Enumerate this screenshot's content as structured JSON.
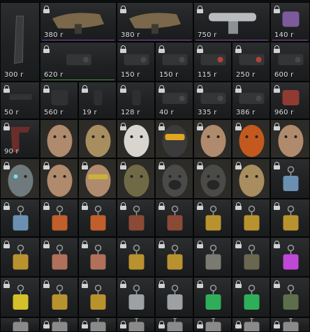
{
  "rows": [
    [
      {
        "icon": "magazine-icon",
        "price": "300 r",
        "span": 2
      },
      {
        "icon": "desert-rifle-stock-icon",
        "price": "380 r",
        "locked": true,
        "wide": 2,
        "underline": "#7a4aa8"
      },
      {
        "icon": "desert-rifle-stock-icon",
        "price": "380 r",
        "locked": true,
        "wide": 2,
        "underline": "#7a4aa8"
      },
      {
        "icon": "silver-scope-icon",
        "price": "750 r",
        "locked": true,
        "wide": 2,
        "underline": "#7a4aa8"
      },
      {
        "icon": "purple-suppressor-icon",
        "price": "140 r",
        "locked": true,
        "underline": "#7a4aa8"
      }
    ],
    [
      {
        "icon": "sniper-scope-icon",
        "price": "620 r",
        "locked": true,
        "wide": 2,
        "underline": "#3f8c3a"
      },
      {
        "icon": "holo-sight-icon",
        "price": "150 r",
        "locked": true
      },
      {
        "icon": "holo-sight-icon",
        "price": "150 r",
        "locked": true
      },
      {
        "icon": "red-dot-sight-icon",
        "price": "115 r",
        "locked": true
      },
      {
        "icon": "red-dot-sight-icon",
        "price": "250 r",
        "locked": true
      },
      {
        "icon": "night-scope-icon",
        "price": "600 r",
        "locked": true
      }
    ],
    [
      {
        "icon": "rail-mount-icon",
        "price": "50 r",
        "locked": true
      },
      {
        "icon": "suppressor-icon",
        "price": "560 r",
        "locked": true
      },
      {
        "icon": "grip-icon",
        "price": "19 r",
        "locked": true
      },
      {
        "icon": "flash-hider-icon",
        "price": "128 r",
        "locked": true
      },
      {
        "icon": "laser-sight-icon",
        "price": "40 r",
        "locked": true
      },
      {
        "icon": "thermal-scope-icon",
        "price": "335 r",
        "locked": true
      },
      {
        "icon": "thermal-scope-icon",
        "price": "386 r",
        "locked": true
      },
      {
        "icon": "red-suppressor-icon",
        "price": "960 r",
        "locked": true
      }
    ],
    [
      {
        "icon": "foregrip-icon",
        "price": "90 r",
        "locked": true
      },
      {
        "icon": "soldier-face-icon",
        "face": true
      },
      {
        "icon": "balaclava-face-icon",
        "face": true
      },
      {
        "icon": "skull-mask-face-icon",
        "face": true,
        "locked": true
      },
      {
        "icon": "goggles-helmet-face-icon",
        "face": true,
        "locked": true
      },
      {
        "icon": "bearded-face-icon",
        "face": true,
        "locked": true
      },
      {
        "icon": "orange-skull-face-icon",
        "face": true,
        "locked": true
      },
      {
        "icon": "soldier-face-icon",
        "face": true,
        "locked": true
      }
    ],
    [
      {
        "icon": "cyborg-face-icon",
        "face": true,
        "locked": true
      },
      {
        "icon": "soldier-face-icon",
        "face": true,
        "locked": true
      },
      {
        "icon": "sunglasses-face-icon",
        "face": true,
        "locked": true
      },
      {
        "icon": "camo-face-icon",
        "face": true,
        "locked": true
      },
      {
        "icon": "gasmask-face-icon",
        "face": true,
        "locked": true
      },
      {
        "icon": "respirator-face-icon",
        "face": true,
        "locked": true
      },
      {
        "icon": "balaclava-face-icon",
        "face": true,
        "locked": true
      },
      {
        "icon": "gear-charm-icon",
        "locked": true
      }
    ],
    [
      {
        "icon": "gear-charm-icon",
        "locked": true
      },
      {
        "icon": "carrot-charm-icon",
        "locked": true
      },
      {
        "icon": "carrot-charm-icon",
        "locked": true
      },
      {
        "icon": "sun-plate-charm-icon",
        "locked": true
      },
      {
        "icon": "sun-plate-charm-icon",
        "locked": true
      },
      {
        "icon": "gold-badge-charm-icon",
        "locked": true
      },
      {
        "icon": "gold-badge-charm-icon",
        "locked": true
      },
      {
        "icon": "gold-badge-charm-icon",
        "locked": true
      }
    ],
    [
      {
        "icon": "gold-badge-charm-icon",
        "locked": true
      },
      {
        "icon": "copper-dogtag-charm-icon",
        "locked": true
      },
      {
        "icon": "copper-dogtag-charm-icon",
        "locked": true
      },
      {
        "icon": "gold-plate-charm-icon",
        "locked": true
      },
      {
        "icon": "gold-plate-charm-icon",
        "locked": true
      },
      {
        "icon": "pumpkin-hammer-charm-icon",
        "locked": true
      },
      {
        "icon": "stone-head-charm-icon",
        "locked": true
      },
      {
        "icon": "purple-vial-charm-icon",
        "locked": true
      }
    ],
    [
      {
        "icon": "yellow-x-charm-icon",
        "locked": true
      },
      {
        "icon": "gold-triangle-charm-icon",
        "locked": true
      },
      {
        "icon": "gold-triangle-charm-icon",
        "locked": true
      },
      {
        "icon": "silver-dogtag-charm-icon",
        "locked": true
      },
      {
        "icon": "silver-dogtag-charm-icon",
        "locked": true
      },
      {
        "icon": "green-canister-charm-icon",
        "locked": true
      },
      {
        "icon": "green-canister-charm-icon",
        "locked": true
      },
      {
        "icon": "robot-charm-icon",
        "locked": true
      }
    ],
    [
      {
        "icon": "charm-icon"
      },
      {
        "icon": "charm-icon",
        "locked": true
      },
      {
        "icon": "charm-icon",
        "locked": true
      },
      {
        "icon": "charm-icon",
        "locked": true
      },
      {
        "icon": "charm-icon",
        "locked": true
      },
      {
        "icon": "charm-icon",
        "locked": true
      },
      {
        "icon": "charm-icon",
        "locked": true
      },
      {
        "icon": "charm-icon",
        "locked": true
      }
    ]
  ]
}
